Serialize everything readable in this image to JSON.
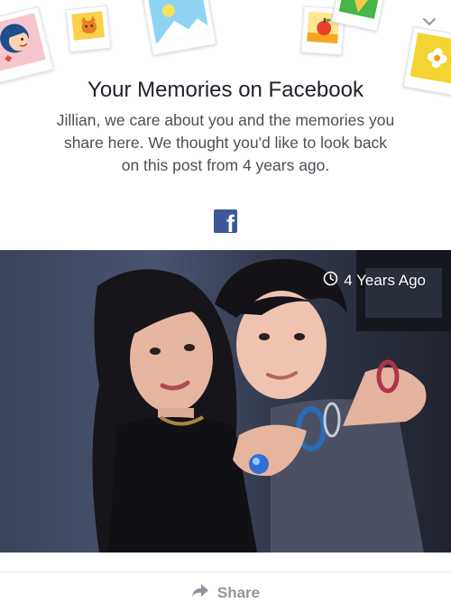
{
  "memory": {
    "title": "Your Memories on Facebook",
    "message": "Jillian, we care about you and the memories you share here. We thought you'd like to look back on this post from 4 years ago.",
    "logo_icon": "facebook-logo-icon",
    "logo_letter": "f"
  },
  "photo": {
    "badge_icon": "clock-icon",
    "badge_text": "4 Years Ago"
  },
  "actions": {
    "share_icon": "share-arrow-icon",
    "share_label": "Share"
  },
  "header": {
    "menu_icon": "chevron-down-icon"
  },
  "colors": {
    "facebook_blue": "#3b5998",
    "title_text": "#1d2129",
    "body_text": "#4b4f56",
    "muted_text": "#90949c"
  }
}
